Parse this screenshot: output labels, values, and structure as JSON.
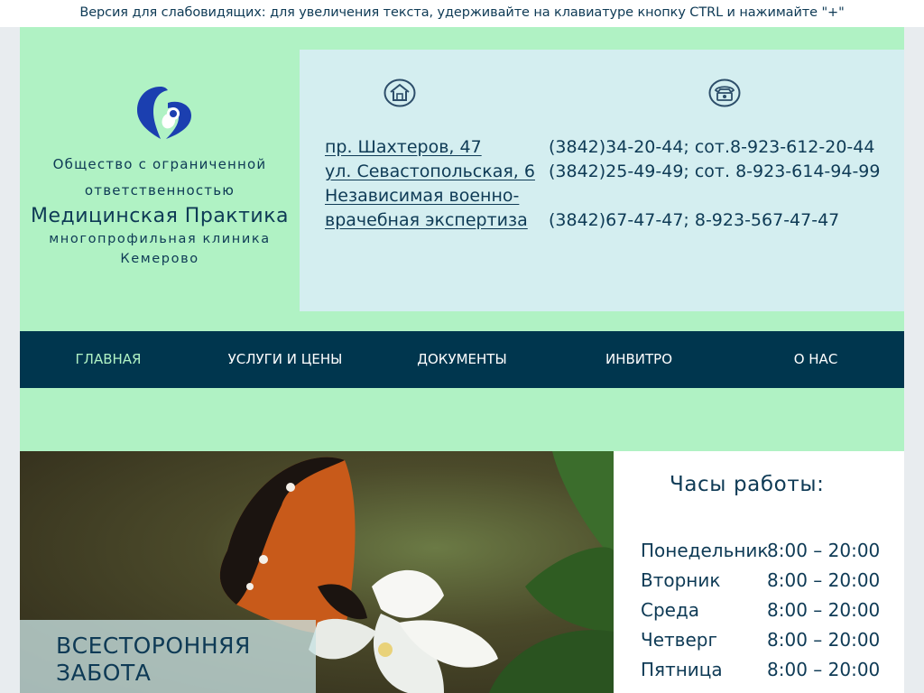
{
  "accessibility_bar": "Версия для слабовидящих: для увеличения текста, удерживайте на клавиатуре кнопку CTRL и нажимайте \"+\"",
  "company": {
    "legal_form": "Общество с ограниченной ответственностью",
    "name": "Медицинская Практика",
    "subtitle": "многопрофильная клиника",
    "city": "Кемерово"
  },
  "addresses": [
    "пр. Шахтеров, 47",
    "ул. Севастопольская, 6",
    "Независимая военно-",
    "врачебная экспертиза"
  ],
  "phones": [
    "(3842)34-20-44; сот.8-923-612-20-44",
    "(3842)25-49-49; сот. 8-923-614-94-99",
    "(3842)67-47-47; 8-923-567-47-47"
  ],
  "nav": [
    "ГЛАВНАЯ",
    "УСЛУГИ И ЦЕНЫ",
    "ДОКУМЕНТЫ",
    "ИНВИТРО",
    "О НАС"
  ],
  "hero": {
    "line1": "ВСЕСТОРОННЯЯ",
    "line2": "ЗАБОТА"
  },
  "hours": {
    "title": "Часы работы:",
    "rows": [
      {
        "day": "Понедельник",
        "time": "8:00 – 20:00"
      },
      {
        "day": "Вторник",
        "time": "8:00 – 20:00"
      },
      {
        "day": "Среда",
        "time": "8:00 – 20:00"
      },
      {
        "day": "Четверг",
        "time": "8:00 – 20:00"
      },
      {
        "day": "Пятница",
        "time": "8:00 – 20:00"
      }
    ]
  },
  "colors": {
    "accent": "#0e3a55",
    "header_bg": "#b0f2c4",
    "nav_bg": "#00364e",
    "contact_bg": "#d4eef0"
  },
  "icons": [
    "logo-heart-icon",
    "house-icon",
    "telephone-icon"
  ]
}
